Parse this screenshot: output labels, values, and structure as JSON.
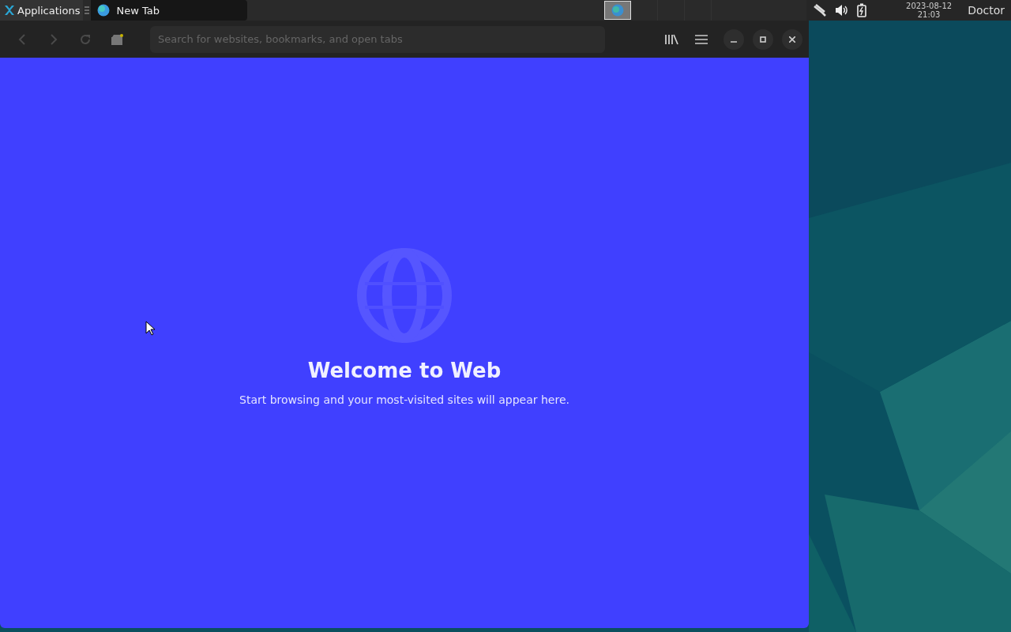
{
  "taskbar": {
    "menu": {
      "label": "Applications"
    },
    "tasks": [
      {
        "label": "New Tab",
        "selected": true
      }
    ],
    "workspaces": [
      {
        "selected": true
      },
      {
        "selected": false
      },
      {
        "selected": false
      },
      {
        "selected": false
      }
    ],
    "clock": {
      "date": "2023-08-12",
      "time": "21:03"
    },
    "user": "Doctor"
  },
  "browser": {
    "nav": [
      {
        "kind": "back",
        "disabled": true
      },
      {
        "kind": "forward",
        "disabled": true
      },
      {
        "kind": "reload",
        "disabled": true
      },
      {
        "kind": "home",
        "disabled": false
      }
    ],
    "search": {
      "placeholder": "Search for websites, bookmarks, and open tabs"
    },
    "page": {
      "title": "Welcome to Web",
      "subtitle": "Start browsing and your most-visited sites will appear here."
    }
  }
}
